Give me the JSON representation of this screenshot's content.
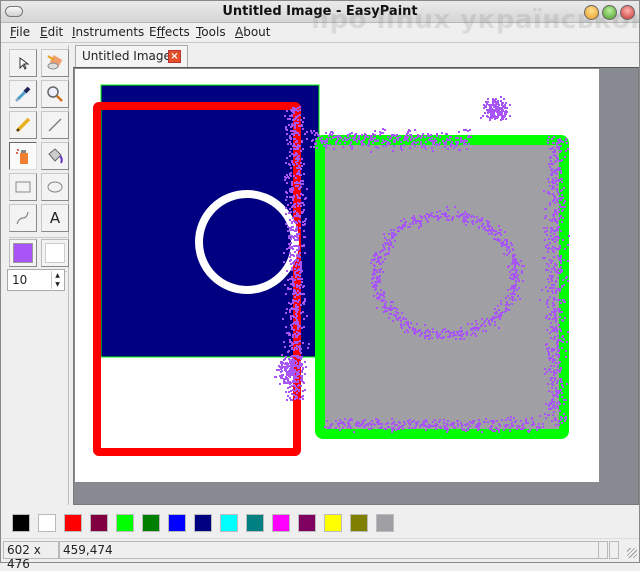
{
  "window": {
    "title": "Untitled Image - EasyPaint",
    "watermark": "про linux українською",
    "controls": [
      "minimize",
      "maximize",
      "close"
    ]
  },
  "menubar": {
    "items": [
      {
        "label": "File",
        "mnemonic": "F"
      },
      {
        "label": "Edit",
        "mnemonic": "E"
      },
      {
        "label": "Instruments",
        "mnemonic": "I"
      },
      {
        "label": "Effects",
        "mnemonic": "f"
      },
      {
        "label": "Tools",
        "mnemonic": "T"
      },
      {
        "label": "About",
        "mnemonic": "A"
      }
    ]
  },
  "toolbox": {
    "tools": [
      {
        "name": "cursor",
        "icon": "cursor-icon",
        "active": false
      },
      {
        "name": "eraser",
        "icon": "eraser-icon",
        "active": false
      },
      {
        "name": "color-picker",
        "icon": "eyedropper-icon",
        "active": false
      },
      {
        "name": "magnifier",
        "icon": "magnifier-icon",
        "active": false
      },
      {
        "name": "pencil",
        "icon": "pencil-icon",
        "active": false
      },
      {
        "name": "line",
        "icon": "line-icon",
        "active": false
      },
      {
        "name": "spray",
        "icon": "spray-icon",
        "active": true
      },
      {
        "name": "fill",
        "icon": "paint-bucket-icon",
        "active": false
      },
      {
        "name": "rectangle",
        "icon": "rectangle-icon",
        "active": false
      },
      {
        "name": "ellipse",
        "icon": "ellipse-icon",
        "active": false
      },
      {
        "name": "curve",
        "icon": "curve-icon",
        "active": false
      },
      {
        "name": "text",
        "icon": "text-icon",
        "label": "A",
        "active": false
      }
    ],
    "primary_color": "#a855f7",
    "secondary_color": "#ffffff",
    "pen_size": "10"
  },
  "tabs": [
    {
      "label": "Untitled Image",
      "active": true
    }
  ],
  "canvas": {
    "size_label": "602 x 476",
    "cursor_pos": "459,474"
  },
  "palette": {
    "colors": [
      "#000000",
      "#ffffff",
      "#ff0000",
      "#800040",
      "#00ff00",
      "#008000",
      "#0000ff",
      "#000080",
      "#00ffff",
      "#008080",
      "#ff00ff",
      "#800060",
      "#ffff00",
      "#808000",
      "#a0a0a4"
    ]
  },
  "statusbar": {
    "size": "602 x 476",
    "position": "459,474"
  }
}
